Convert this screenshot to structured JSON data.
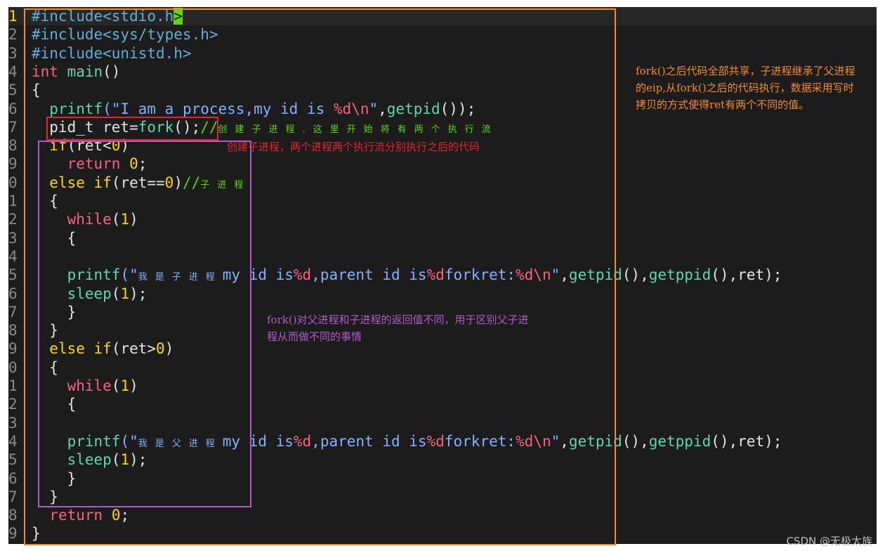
{
  "colors": {
    "background": "#1c1c1c",
    "preproc": "#5fafd7",
    "keyword": "#ff5f87",
    "builtin_kw": "#ffd700",
    "function": "#5fd7af",
    "string": "#87afff",
    "number": "#ffd700",
    "comment": "#5fd700",
    "text": "#e4e4e4",
    "orange_box": "#f28c28",
    "red_box": "#e3262d",
    "purple_box": "#b25ac8"
  },
  "gutter": [
    "1",
    "2",
    "3",
    "4",
    "5",
    "6",
    "7",
    "8",
    "9",
    "0",
    "1",
    "2",
    "3",
    "4",
    "5",
    "6",
    "7",
    "8",
    "9",
    "0",
    "1",
    "2",
    "3",
    "4",
    "5",
    "6",
    "7",
    "8",
    "9"
  ],
  "lines": [
    [
      [
        "#include<stdio.h",
        "preproc"
      ],
      [
        ">",
        "cursor"
      ]
    ],
    [
      [
        "#include<sys/types.h>",
        "preproc"
      ]
    ],
    [
      [
        "#include<unistd.h>",
        "preproc"
      ]
    ],
    [
      [
        "int ",
        "keyword"
      ],
      [
        "main",
        "function"
      ],
      [
        "()",
        "text"
      ]
    ],
    [
      [
        "{",
        "text"
      ]
    ],
    [
      [
        "  ",
        "text"
      ],
      [
        "printf",
        "function"
      ],
      [
        "(\"I am a process,my id is ",
        "string"
      ],
      [
        "%d\\n",
        "keyword"
      ],
      [
        "\"",
        "string"
      ],
      [
        ",",
        "text"
      ],
      [
        "getpid",
        "function"
      ],
      [
        "());",
        "text"
      ]
    ],
    [
      [
        "  pid_t ret=",
        "text"
      ],
      [
        "fork",
        "function"
      ],
      [
        "();",
        "text"
      ],
      [
        "//",
        "comment"
      ],
      [
        "创建子进程.这里开始将有两个执行流",
        "comment-cn"
      ]
    ],
    [
      [
        "  ",
        "text"
      ],
      [
        "if",
        "builtin_kw"
      ],
      [
        "(ret<",
        "text"
      ],
      [
        "0",
        "number"
      ],
      [
        ")",
        "text"
      ]
    ],
    [
      [
        "    ",
        "text"
      ],
      [
        "return ",
        "keyword"
      ],
      [
        "0",
        "number"
      ],
      [
        ";",
        "text"
      ]
    ],
    [
      [
        "  ",
        "text"
      ],
      [
        "else if",
        "builtin_kw"
      ],
      [
        "(ret==",
        "text"
      ],
      [
        "0",
        "number"
      ],
      [
        ")",
        "text"
      ],
      [
        "//",
        "comment"
      ],
      [
        "子进程",
        "comment-cn"
      ]
    ],
    [
      [
        "  {",
        "text"
      ]
    ],
    [
      [
        "    ",
        "text"
      ],
      [
        "while",
        "keyword"
      ],
      [
        "(",
        "text"
      ],
      [
        "1",
        "number"
      ],
      [
        ")",
        "text"
      ]
    ],
    [
      [
        "    {",
        "text"
      ]
    ],
    [
      [
        "",
        "text"
      ]
    ],
    [
      [
        "    ",
        "text"
      ],
      [
        "printf",
        "function"
      ],
      [
        "(\"",
        "string"
      ],
      [
        "我是子进程",
        "string-cn"
      ],
      [
        "my id is",
        "string"
      ],
      [
        "%d",
        "keyword"
      ],
      [
        ",parent id is",
        "string"
      ],
      [
        "%d",
        "keyword"
      ],
      [
        "forkret:",
        "string"
      ],
      [
        "%d\\n",
        "keyword"
      ],
      [
        "\"",
        "string"
      ],
      [
        ",",
        "text"
      ],
      [
        "getpid",
        "function"
      ],
      [
        "(),",
        "text"
      ],
      [
        "getppid",
        "function"
      ],
      [
        "(),ret);",
        "text"
      ]
    ],
    [
      [
        "    ",
        "text"
      ],
      [
        "sleep",
        "function"
      ],
      [
        "(",
        "text"
      ],
      [
        "1",
        "number"
      ],
      [
        ");",
        "text"
      ]
    ],
    [
      [
        "    }",
        "text"
      ]
    ],
    [
      [
        "  }",
        "text"
      ]
    ],
    [
      [
        "  ",
        "text"
      ],
      [
        "else if",
        "builtin_kw"
      ],
      [
        "(ret>",
        "text"
      ],
      [
        "0",
        "number"
      ],
      [
        ")",
        "text"
      ]
    ],
    [
      [
        "  {",
        "text"
      ]
    ],
    [
      [
        "    ",
        "text"
      ],
      [
        "while",
        "keyword"
      ],
      [
        "(",
        "text"
      ],
      [
        "1",
        "number"
      ],
      [
        ")",
        "text"
      ]
    ],
    [
      [
        "    {",
        "text"
      ]
    ],
    [
      [
        "",
        "text"
      ]
    ],
    [
      [
        "    ",
        "text"
      ],
      [
        "printf",
        "function"
      ],
      [
        "(\"",
        "string"
      ],
      [
        "我是父进程",
        "string-cn"
      ],
      [
        "my id is",
        "string"
      ],
      [
        "%d",
        "keyword"
      ],
      [
        ",parent id is",
        "string"
      ],
      [
        "%d",
        "keyword"
      ],
      [
        "forkret:",
        "string"
      ],
      [
        "%d\\n",
        "keyword"
      ],
      [
        "\"",
        "string"
      ],
      [
        ",",
        "text"
      ],
      [
        "getpid",
        "function"
      ],
      [
        "(),",
        "text"
      ],
      [
        "getppid",
        "function"
      ],
      [
        "(),ret);",
        "text"
      ]
    ],
    [
      [
        "    ",
        "text"
      ],
      [
        "sleep",
        "function"
      ],
      [
        "(",
        "text"
      ],
      [
        "1",
        "number"
      ],
      [
        ");",
        "text"
      ]
    ],
    [
      [
        "    }",
        "text"
      ]
    ],
    [
      [
        "  }",
        "text"
      ]
    ],
    [
      [
        "  ",
        "text"
      ],
      [
        "return ",
        "keyword"
      ],
      [
        "0",
        "number"
      ],
      [
        ";",
        "text"
      ]
    ],
    [
      [
        "}",
        "text"
      ]
    ]
  ],
  "notes": {
    "orange": "fork()之后代码全部共享，子进程继承了父进程的eip,从fork()之后的代码执行，数据采用写时拷贝的方式使得ret有两个不同的值。",
    "red": "创建子进程，两个进程两个执行流分别执行之后的代码",
    "purple": "fork()对父进程和子进程的返回值不同，用于区别父子进程从而做不同的事情"
  },
  "watermark": "CSDN @无极太族"
}
